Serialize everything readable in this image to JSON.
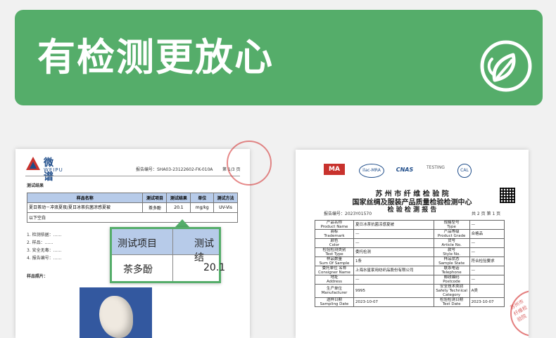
{
  "banner": {
    "title": "有检测更放心",
    "icon": "leaf-icon",
    "bg": "#55ad6a"
  },
  "doc1": {
    "logo_text": "微谱",
    "logo_sub": "WEIPU",
    "report_no": "报告编号：SHA03-23122602-FK-010A",
    "page": "第 1/3 页",
    "section_results": "测试结果",
    "columns": [
      "样品名称",
      "测试项目",
      "测试结果",
      "单位",
      "测试方法"
    ],
    "row": {
      "sample": "夏日茶动－冲浪夏夜/夏日冰茶抗菌凉感夏被",
      "item": "茶多酚",
      "result": "20.1",
      "unit": "mg/kg",
      "method": "UV-Vis"
    },
    "blank_note": "以下空白",
    "notes": [
      "1. 检测依据：……",
      "2. 样品：……",
      "3. 安全无毒：……",
      "4. 报告编号：……"
    ],
    "section_photo": "样品照片："
  },
  "zoom": {
    "col1": "测试项目",
    "col2": "测试结",
    "name": "茶多酚",
    "value": "20.1"
  },
  "doc2": {
    "badges": [
      "MA",
      "ilac-MRA",
      "CNAS",
      "TESTING",
      "CAL"
    ],
    "org1": "苏 州 市 纤 维 检 验 院",
    "org2": "国家丝绸及服装产品质量检验检测中心",
    "org3": "检 验 检 测 报 告",
    "report_no": "报告编号：2023Y01570",
    "page": "共 2 页 第 1 页",
    "rows": [
      {
        "l1": "产品名称",
        "l1e": "Product Name",
        "v1": "夏日冰茶抗菌凉感夏被",
        "l2": "规格型号",
        "l2e": "Type",
        "v2": "—"
      },
      {
        "l1": "商标",
        "l1e": "Trademark",
        "v1": "—",
        "l2": "产品等级",
        "l2e": "Product Grade",
        "v2": "合格品"
      },
      {
        "l1": "颜色",
        "l1e": "Color",
        "v1": "—",
        "l2": "货号",
        "l2e": "Article No.",
        "v2": "—"
      },
      {
        "l1": "检验检测类别",
        "l1e": "Test Type",
        "v1": "委托检测",
        "l2": "款号",
        "l2e": "Style No.",
        "v2": "—"
      },
      {
        "l1": "样品数量",
        "l1e": "Sum Of Sample",
        "v1": "1条",
        "l2": "样品状态",
        "l2e": "Sample State",
        "v2": "符合检验要求"
      },
      {
        "l1": "名称",
        "l1e": "Name",
        "v1": "上海水星家用纺织品股份有限公司",
        "l2": "联系电话",
        "l2e": "Telephone",
        "v2": "—"
      },
      {
        "l1": "地址",
        "l1e": "Address",
        "v1": "—",
        "l2": "邮政编码",
        "l2e": "Postcode",
        "v2": "—"
      },
      {
        "l1": "生产单位",
        "l1e": "Manufacturer",
        "v1": "9995",
        "l2": "安全技术类别",
        "l2e": "Safety Technical Category",
        "v2": "A类"
      },
      {
        "l1": "送样日期",
        "l1e": "Sampling Date",
        "v1": "2023-10-07",
        "l2": "检验检测日期",
        "l2e": "Test Date",
        "v2": "2023-10-07"
      }
    ],
    "entrust_label": "委托单位",
    "entrust_label_en": "Consigner",
    "stamp_text": "苏州市纤维检验院"
  }
}
